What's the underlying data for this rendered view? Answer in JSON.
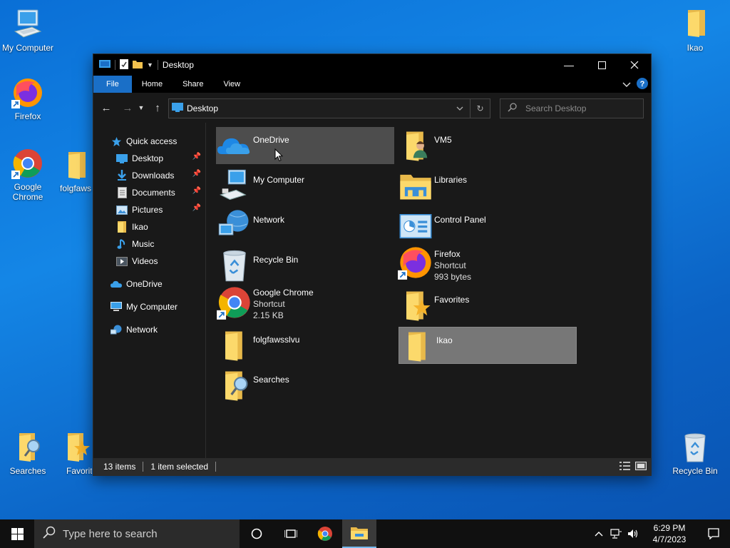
{
  "desktop": {
    "icons": {
      "my_computer": "My Computer",
      "firefox": "Firefox",
      "google_chrome": "Google Chrome",
      "folgfaws": "folgfaws",
      "ikao": "Ikao",
      "searches": "Searches",
      "favorites": "Favorit",
      "recycle_bin": "Recycle Bin"
    }
  },
  "window": {
    "title": "Desktop",
    "ribbon_tabs": [
      "File",
      "Home",
      "Share",
      "View"
    ],
    "address": "Desktop",
    "search_placeholder": "Search Desktop",
    "nav_pane": {
      "quick_access": "Quick access",
      "items": [
        "Desktop",
        "Downloads",
        "Documents",
        "Pictures",
        "Ikao",
        "Music",
        "Videos"
      ],
      "onedrive": "OneDrive",
      "my_computer": "My Computer",
      "network": "Network"
    },
    "files": [
      {
        "name": "OneDrive",
        "sub1": "",
        "sub2": "",
        "icon": "onedrive-icon"
      },
      {
        "name": "VM5",
        "sub1": "",
        "sub2": "",
        "icon": "user-folder-icon"
      },
      {
        "name": "My Computer",
        "sub1": "",
        "sub2": "",
        "icon": "computer-icon"
      },
      {
        "name": "Libraries",
        "sub1": "",
        "sub2": "",
        "icon": "libraries-icon"
      },
      {
        "name": "Network",
        "sub1": "",
        "sub2": "",
        "icon": "network-icon"
      },
      {
        "name": "Control Panel",
        "sub1": "",
        "sub2": "",
        "icon": "control-panel-icon"
      },
      {
        "name": "Recycle Bin",
        "sub1": "",
        "sub2": "",
        "icon": "recycle-bin-icon"
      },
      {
        "name": "Firefox",
        "sub1": "Shortcut",
        "sub2": "993 bytes",
        "icon": "firefox-icon"
      },
      {
        "name": "Google Chrome",
        "sub1": "Shortcut",
        "sub2": "2.15 KB",
        "icon": "chrome-icon"
      },
      {
        "name": "Favorites",
        "sub1": "",
        "sub2": "",
        "icon": "favorites-folder-icon"
      },
      {
        "name": "folgfawsslvu",
        "sub1": "",
        "sub2": "",
        "icon": "folder-icon"
      },
      {
        "name": "Ikao",
        "sub1": "",
        "sub2": "",
        "icon": "folder-icon"
      },
      {
        "name": "Searches",
        "sub1": "",
        "sub2": "",
        "icon": "searches-folder-icon"
      }
    ],
    "status": {
      "items_count": "13 items",
      "selected": "1 item selected"
    }
  },
  "taskbar": {
    "search_placeholder": "Type here to search",
    "time": "6:29 PM",
    "date": "4/7/2023"
  },
  "colors": {
    "accent": "#1a6fc7",
    "window_bg": "#191919",
    "selection": "#777777"
  }
}
